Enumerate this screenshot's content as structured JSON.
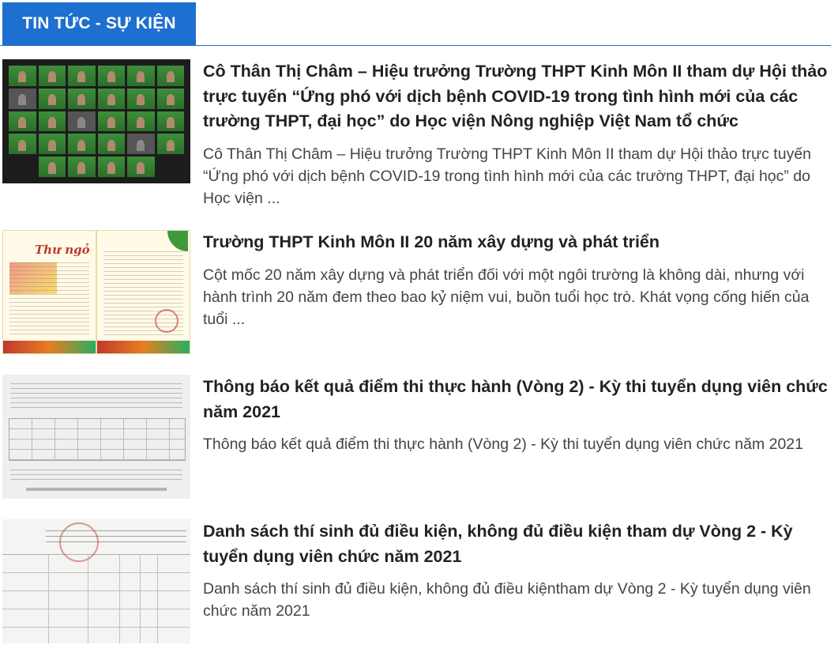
{
  "header": {
    "title": "TIN TỨC - SỰ KIỆN"
  },
  "articles": [
    {
      "title": "Cô Thân Thị Châm – Hiệu trưởng Trường THPT Kinh Môn II tham dự Hội thảo trực tuyến “Ứng phó với dịch bệnh COVID-19 trong tình hình mới của các trường THPT, đại học” do Học viện Nông nghiệp Việt Nam tổ chức",
      "summary": "Cô Thân Thị Châm – Hiệu trưởng Trường THPT Kinh Môn II tham dự Hội thảo trực tuyến “Ứng phó với dịch bệnh COVID-19 trong tình hình mới của các trường THPT, đại học” do Học viện ..."
    },
    {
      "title": "Trường THPT Kinh Môn II 20 năm xây dựng và phát triển",
      "summary": "Cột mốc 20 năm xây dựng và phát triển đối với một ngôi trường là không dài, nhưng với hành trình 20 năm đem theo bao kỷ niệm vui, buồn tuổi học trò. Khát vọng cống hiến của tuổi ...",
      "thumb_text": "Thư ngỏ"
    },
    {
      "title": "Thông báo kết quả điểm thi thực hành (Vòng 2) - Kỳ thi tuyển dụng viên chức năm 2021",
      "summary": "Thông báo kết quả điểm thi thực hành (Vòng 2) - Kỳ thi tuyển dụng viên chức năm 2021"
    },
    {
      "title": "Danh sách thí sinh đủ điều kiện, không đủ điều kiện tham dự Vòng 2 - Kỳ tuyển dụng viên chức năm 2021",
      "summary": "Danh sách thí sinh đủ điều kiện, không đủ điều kiệntham dự Vòng 2 - Kỳ tuyển dụng viên chức năm 2021"
    }
  ],
  "colors": {
    "accent": "#1d6fd0",
    "title": "#222222",
    "summary": "#444444"
  }
}
